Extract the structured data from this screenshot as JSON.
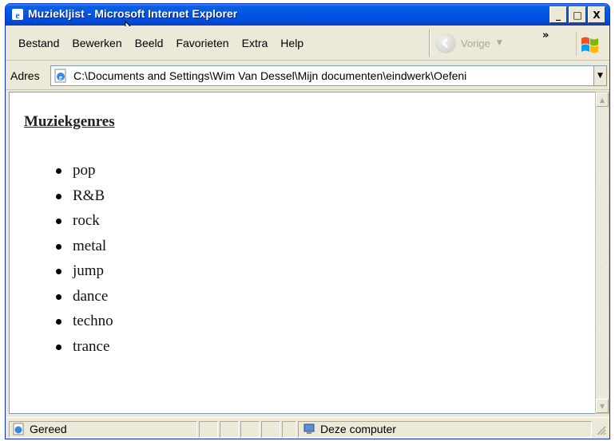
{
  "window": {
    "title": "Muziekljist - Microsoft Internet Explorer",
    "caption_buttons": [
      "_",
      "□",
      "X"
    ]
  },
  "menubar": {
    "items": [
      "Bestand",
      "Bewerken",
      "Beeld",
      "Favorieten",
      "Extra",
      "Help"
    ]
  },
  "toolbar": {
    "back_label": "Vorige",
    "more": "»"
  },
  "address": {
    "label": "Adres",
    "value": "C:\\Documents and Settings\\Wim Van Dessel\\Mijn documenten\\eindwerk\\Oefeni"
  },
  "page": {
    "heading": "Muziekgenres",
    "genres": [
      "pop",
      "R&B",
      "rock",
      "metal",
      "jump",
      "dance",
      "techno",
      "trance"
    ]
  },
  "status": {
    "text": "Gereed",
    "zone": "Deze computer"
  },
  "colors": {
    "titlebar": "#0055e5",
    "chrome": "#ece9d8",
    "border": "#7f9db9"
  }
}
